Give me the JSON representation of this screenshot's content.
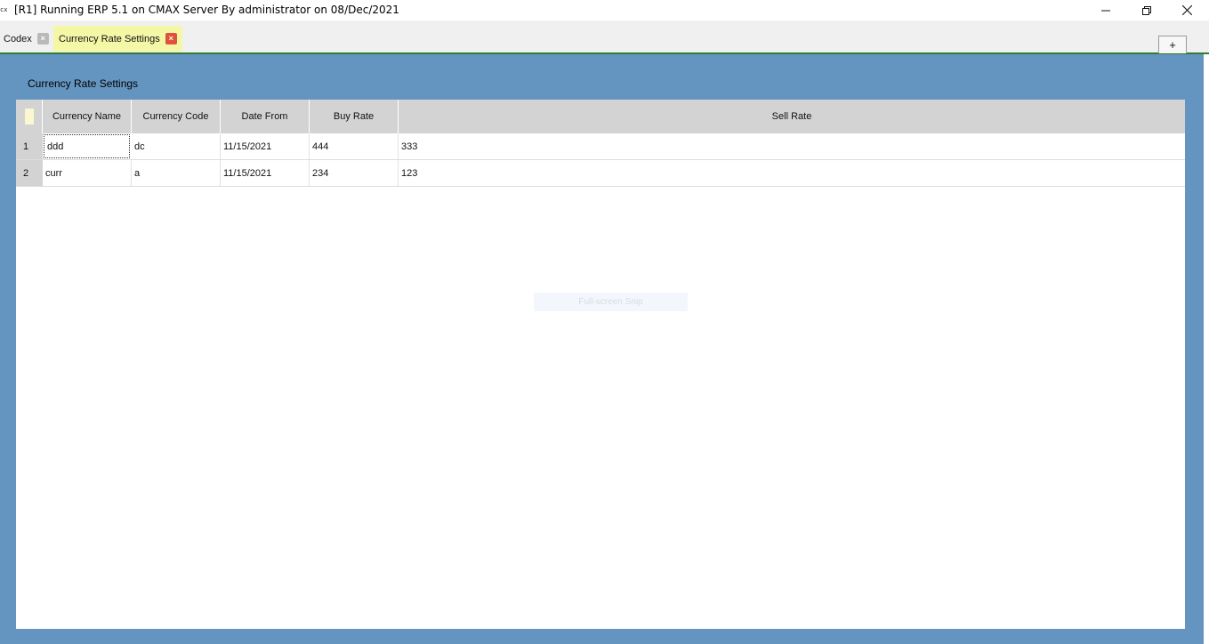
{
  "window": {
    "icon_text": "cx",
    "title": "[R1] Running ERP 5.1 on CMAX Server By administrator on 08/Dec/2021"
  },
  "tabs": [
    {
      "label": "Codex",
      "close": "×"
    },
    {
      "label": "Currency Rate Settings",
      "close": "×"
    }
  ],
  "add_tab_label": "+",
  "page": {
    "title": "Currency Rate Settings"
  },
  "grid": {
    "columns": [
      "Currency Name",
      "Currency Code",
      "Date From",
      "Buy Rate",
      "Sell Rate"
    ],
    "rows": [
      {
        "index": "1",
        "name": "ddd",
        "code": "dc",
        "date": "11/15/2021",
        "buy": "444",
        "sell": "333"
      },
      {
        "index": "2",
        "name": "curr",
        "code": "a",
        "date": "11/15/2021",
        "buy": "234",
        "sell": "123"
      }
    ]
  },
  "overlay": {
    "snip_label": "Full-screen Snip"
  },
  "colors": {
    "background_blue": "#6495c0",
    "active_tab": "#f4f7a6",
    "tab_close_active": "#e0533a",
    "tabbar_underline": "#2e7d32",
    "header_gray": "#d3d3d3"
  }
}
